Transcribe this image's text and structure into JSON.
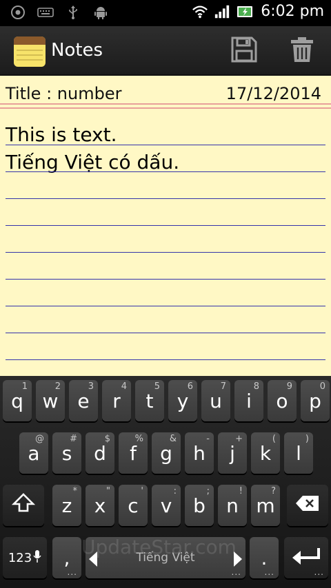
{
  "status_bar": {
    "time": "6:02 pm",
    "left_icons": [
      "power-icon",
      "keyboard-icon",
      "usb-icon",
      "android-debug-icon"
    ],
    "right_icons": [
      "wifi-icon",
      "signal-icon",
      "battery-charging-icon"
    ]
  },
  "action_bar": {
    "title": "Notes",
    "icon": "notepad-icon",
    "actions": [
      "save-icon",
      "trash-icon"
    ]
  },
  "note": {
    "title_label": "Title : number",
    "date": "17/12/2014",
    "lines": [
      "This is text.",
      "Tiếng Việt có dấu."
    ]
  },
  "keyboard": {
    "row1": [
      {
        "k": "q",
        "s": "1"
      },
      {
        "k": "w",
        "s": "2"
      },
      {
        "k": "e",
        "s": "3"
      },
      {
        "k": "r",
        "s": "4"
      },
      {
        "k": "t",
        "s": "5"
      },
      {
        "k": "y",
        "s": "6"
      },
      {
        "k": "u",
        "s": "7"
      },
      {
        "k": "i",
        "s": "8"
      },
      {
        "k": "o",
        "s": "9"
      },
      {
        "k": "p",
        "s": "0"
      }
    ],
    "row2": [
      {
        "k": "a",
        "s": "@"
      },
      {
        "k": "s",
        "s": "#"
      },
      {
        "k": "d",
        "s": "$"
      },
      {
        "k": "f",
        "s": "%"
      },
      {
        "k": "g",
        "s": "&"
      },
      {
        "k": "h",
        "s": "-"
      },
      {
        "k": "j",
        "s": "+"
      },
      {
        "k": "k",
        "s": "("
      },
      {
        "k": "l",
        "s": ")"
      }
    ],
    "row3": [
      {
        "k": "z",
        "s": "*"
      },
      {
        "k": "x",
        "s": "\""
      },
      {
        "k": "c",
        "s": "'"
      },
      {
        "k": "v",
        "s": ":"
      },
      {
        "k": "b",
        "s": ";"
      },
      {
        "k": "n",
        "s": "!"
      },
      {
        "k": "m",
        "s": "?"
      }
    ],
    "sym_label": "123",
    "comma": ",",
    "space_label": "Tiếng Việt",
    "period": ".",
    "watermark": "UpdateStar.com"
  },
  "colors": {
    "paper": "#fff8c5",
    "rule_blue": "#3333aa",
    "rule_red": "#e8a09a",
    "status_green": "#4caf50"
  }
}
